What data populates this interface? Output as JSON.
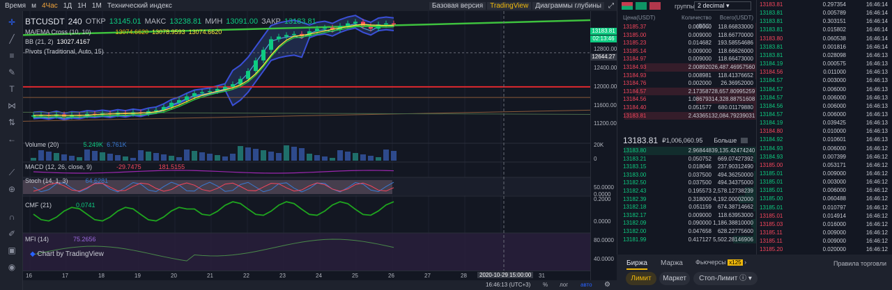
{
  "topbar": {
    "items": [
      "Время",
      "м",
      "4Час",
      "1Д",
      "1Н",
      "1М",
      "Технический индекс"
    ],
    "selected": "4Час",
    "right": [
      "Базовая версия",
      "TradingView",
      "Диаграммы глубины"
    ],
    "right_selected": "TradingView"
  },
  "legend": {
    "symbol": "BTCUSDT",
    "interval": "240",
    "open_label": "ОТКР",
    "open": "13145.01",
    "high_label": "МАКС",
    "high": "13238.81",
    "low_label": "МИН",
    "low": "13091.00",
    "close_label": "ЗАКР",
    "close": "13183.81",
    "ma": "MA/EMA Cross (10, 10)",
    "ma_v1": "13074.6620",
    "ma_v2": "13078.9593",
    "ma_v3": "13074.6620",
    "bb": "BB (21, 2)",
    "bb_v": "13027.4167",
    "pivots": "Pivots (Traditional, Auto, 15)",
    "volume": "Volume (20)",
    "vol_v1": "5.249K",
    "vol_v2": "6.761K",
    "macd": "MACD (12, 26, close, 9)",
    "macd_v1": "-29.7475",
    "macd_v2": "181.5155",
    "stoch": "Stoch (14, 1, 3)",
    "stoch_v": "64.6281",
    "cmf": "CMF (21)",
    "cmf_v": "0.0741",
    "mfi": "MFI (14)",
    "mfi_v": "75.2656"
  },
  "price_axis": {
    "ticks": [
      "12800.00",
      "12400.00",
      "12000.00",
      "11600.00",
      "11200.00"
    ],
    "last": "13183.81",
    "countdown": "02:13:46",
    "pivot": "12644.27",
    "vol_ticks": [
      "20K",
      "0"
    ],
    "stoch_ticks": [
      "50.0000",
      "0.0000"
    ],
    "cmf_ticks": [
      "0.2000",
      "0.0000"
    ],
    "mfi_ticks": [
      "80.0000",
      "40.0000"
    ]
  },
  "time_axis": {
    "labels": [
      "16",
      "17",
      "18",
      "19",
      "20",
      "21",
      "22",
      "23",
      "24",
      "25",
      "26",
      "27",
      "28",
      "31"
    ],
    "crosshair": "2020-10-29 15:00:00"
  },
  "status": {
    "clock": "16:46:13 (UTC+3)",
    "pct": "%",
    "log": "лог",
    "auto": "авто"
  },
  "watermark": "Chart by TradingView",
  "orderbook": {
    "groups_label": "группы",
    "decimal": "2 decimal",
    "headers": [
      "Цена(USDT)",
      "Количество (BTC)",
      "Всего(USDT)"
    ],
    "asks": [
      [
        "13185.37",
        "0.009000",
        "118.66833000"
      ],
      [
        "13185.00",
        "0.009000",
        "118.66770000"
      ],
      [
        "13185.23",
        "0.014682",
        "193.58554686"
      ],
      [
        "13185.14",
        "0.009000",
        "118.66626000"
      ],
      [
        "13184.97",
        "0.009000",
        "118.66473000"
      ],
      [
        "13184.93",
        "2.008920",
        "26,487.46957560"
      ],
      [
        "13184.93",
        "0.008981",
        "118.41376652"
      ],
      [
        "13184.76",
        "0.002000",
        "26.36952000"
      ],
      [
        "13184.57",
        "2.173587",
        "28,657.80995259"
      ],
      [
        "13184.56",
        "1.086793",
        "14,328.88751608"
      ],
      [
        "13184.40",
        "0.051577",
        "680.01179880"
      ],
      [
        "13183.81",
        "2.433651",
        "32,084.79239031"
      ]
    ],
    "mid_price": "13183.81",
    "mid_rub": "₽1,006,060.95",
    "more": "Больше",
    "bids": [
      [
        "13183.80",
        "2.968448",
        "39,135.42474240"
      ],
      [
        "13183.21",
        "0.050752",
        "669.07427392"
      ],
      [
        "13183.15",
        "0.018046",
        "237.90312490"
      ],
      [
        "13183.00",
        "0.037500",
        "494.36250000"
      ],
      [
        "13182.50",
        "0.037500",
        "494.34375000"
      ],
      [
        "13182.43",
        "0.195573",
        "2,578.12738239"
      ],
      [
        "13182.39",
        "0.318000",
        "4,192.00002000"
      ],
      [
        "13182.18",
        "0.051159",
        "674.38714662"
      ],
      [
        "13182.17",
        "0.009000",
        "118.63953000"
      ],
      [
        "13182.09",
        "0.090000",
        "1,186.38810000"
      ],
      [
        "13182.00",
        "0.047658",
        "628.22775600"
      ],
      [
        "13181.99",
        "0.417127",
        "5,502.28146906"
      ]
    ]
  },
  "trades": [
    [
      "13183.81",
      "0.297354",
      "16:46:14"
    ],
    [
      "13183.81",
      "0.005789",
      "16:46:14"
    ],
    [
      "13183.81",
      "0.303151",
      "16:46:14"
    ],
    [
      "13183.81",
      "0.015802",
      "16:46:14"
    ],
    [
      "13183.80",
      "0.060538",
      "16:46:14"
    ],
    [
      "13183.81",
      "0.001816",
      "16:46:14"
    ],
    [
      "13183.81",
      "0.028098",
      "16:46:13"
    ],
    [
      "13184.19",
      "0.000575",
      "16:46:13"
    ],
    [
      "13184.56",
      "0.011000",
      "16:46:13"
    ],
    [
      "13184.57",
      "0.003000",
      "16:46:13"
    ],
    [
      "13184.57",
      "0.006000",
      "16:46:13"
    ],
    [
      "13184.57",
      "0.006000",
      "16:46:13"
    ],
    [
      "13184.56",
      "0.006000",
      "16:46:13"
    ],
    [
      "13184.57",
      "0.006000",
      "16:46:13"
    ],
    [
      "13184.19",
      "0.039425",
      "16:46:13"
    ],
    [
      "13184.80",
      "0.010000",
      "16:46:13"
    ],
    [
      "13184.92",
      "0.010601",
      "16:46:13"
    ],
    [
      "13184.93",
      "0.006000",
      "16:46:12"
    ],
    [
      "13184.93",
      "0.007399",
      "16:46:12"
    ],
    [
      "13185.00",
      "0.053171",
      "16:46:12"
    ],
    [
      "13185.01",
      "0.009000",
      "16:46:12"
    ],
    [
      "13185.01",
      "0.003000",
      "16:46:12"
    ],
    [
      "13185.01",
      "0.006000",
      "16:46:12"
    ],
    [
      "13185.00",
      "0.060488",
      "16:46:12"
    ],
    [
      "13185.01",
      "0.010797",
      "16:46:12"
    ],
    [
      "13185.01",
      "0.014914",
      "16:46:12"
    ],
    [
      "13185.03",
      "0.016000",
      "16:46:12"
    ],
    [
      "13185.11",
      "0.009000",
      "16:46:12"
    ],
    [
      "13185.11",
      "0.009000",
      "16:46:12"
    ],
    [
      "13185.20",
      "0.020000",
      "16:46:12"
    ]
  ],
  "trade_sides": [
    "s",
    "b",
    "b",
    "b",
    "s",
    "b",
    "b",
    "b",
    "s",
    "b",
    "b",
    "b",
    "b",
    "b",
    "b",
    "s",
    "b",
    "b",
    "b",
    "s",
    "b",
    "b",
    "b",
    "b",
    "b",
    "s",
    "s",
    "s",
    "s",
    "s"
  ],
  "bottom": {
    "tabs": [
      "Биржа",
      "Маржа",
      "Фьючерсы"
    ],
    "badge": "x125",
    "right": "Правила торговли",
    "buttons": [
      "Лимит",
      "Маркет",
      "Стоп-Лимит"
    ]
  },
  "colors": {
    "up": "#0ecb81",
    "down": "#f6465d",
    "accent": "#f0b90b",
    "ma": "#ffeb3b",
    "bb": "#3a4fd8"
  },
  "chart_data": {
    "type": "candlestick",
    "symbol": "BTCUSDT",
    "interval": "240",
    "closes": [
      11460,
      11470,
      11450,
      11480,
      11440,
      11470,
      11460,
      11490,
      11480,
      11500,
      11480,
      11510,
      11490,
      11520,
      11500,
      11540,
      11560,
      11620,
      11700,
      11750,
      11820,
      11880,
      11900,
      11920,
      11960,
      12000,
      12050,
      12150,
      12300,
      12500,
      12700,
      12900,
      12950,
      12980,
      13000,
      12960,
      13050,
      13100,
      13120,
      13080,
      13150,
      13200,
      13230,
      13150,
      13100,
      13180,
      13200,
      13183
    ],
    "ylim": [
      11000,
      13300
    ],
    "pivot": 12644.27,
    "levels": [
      12000,
      11800
    ]
  }
}
